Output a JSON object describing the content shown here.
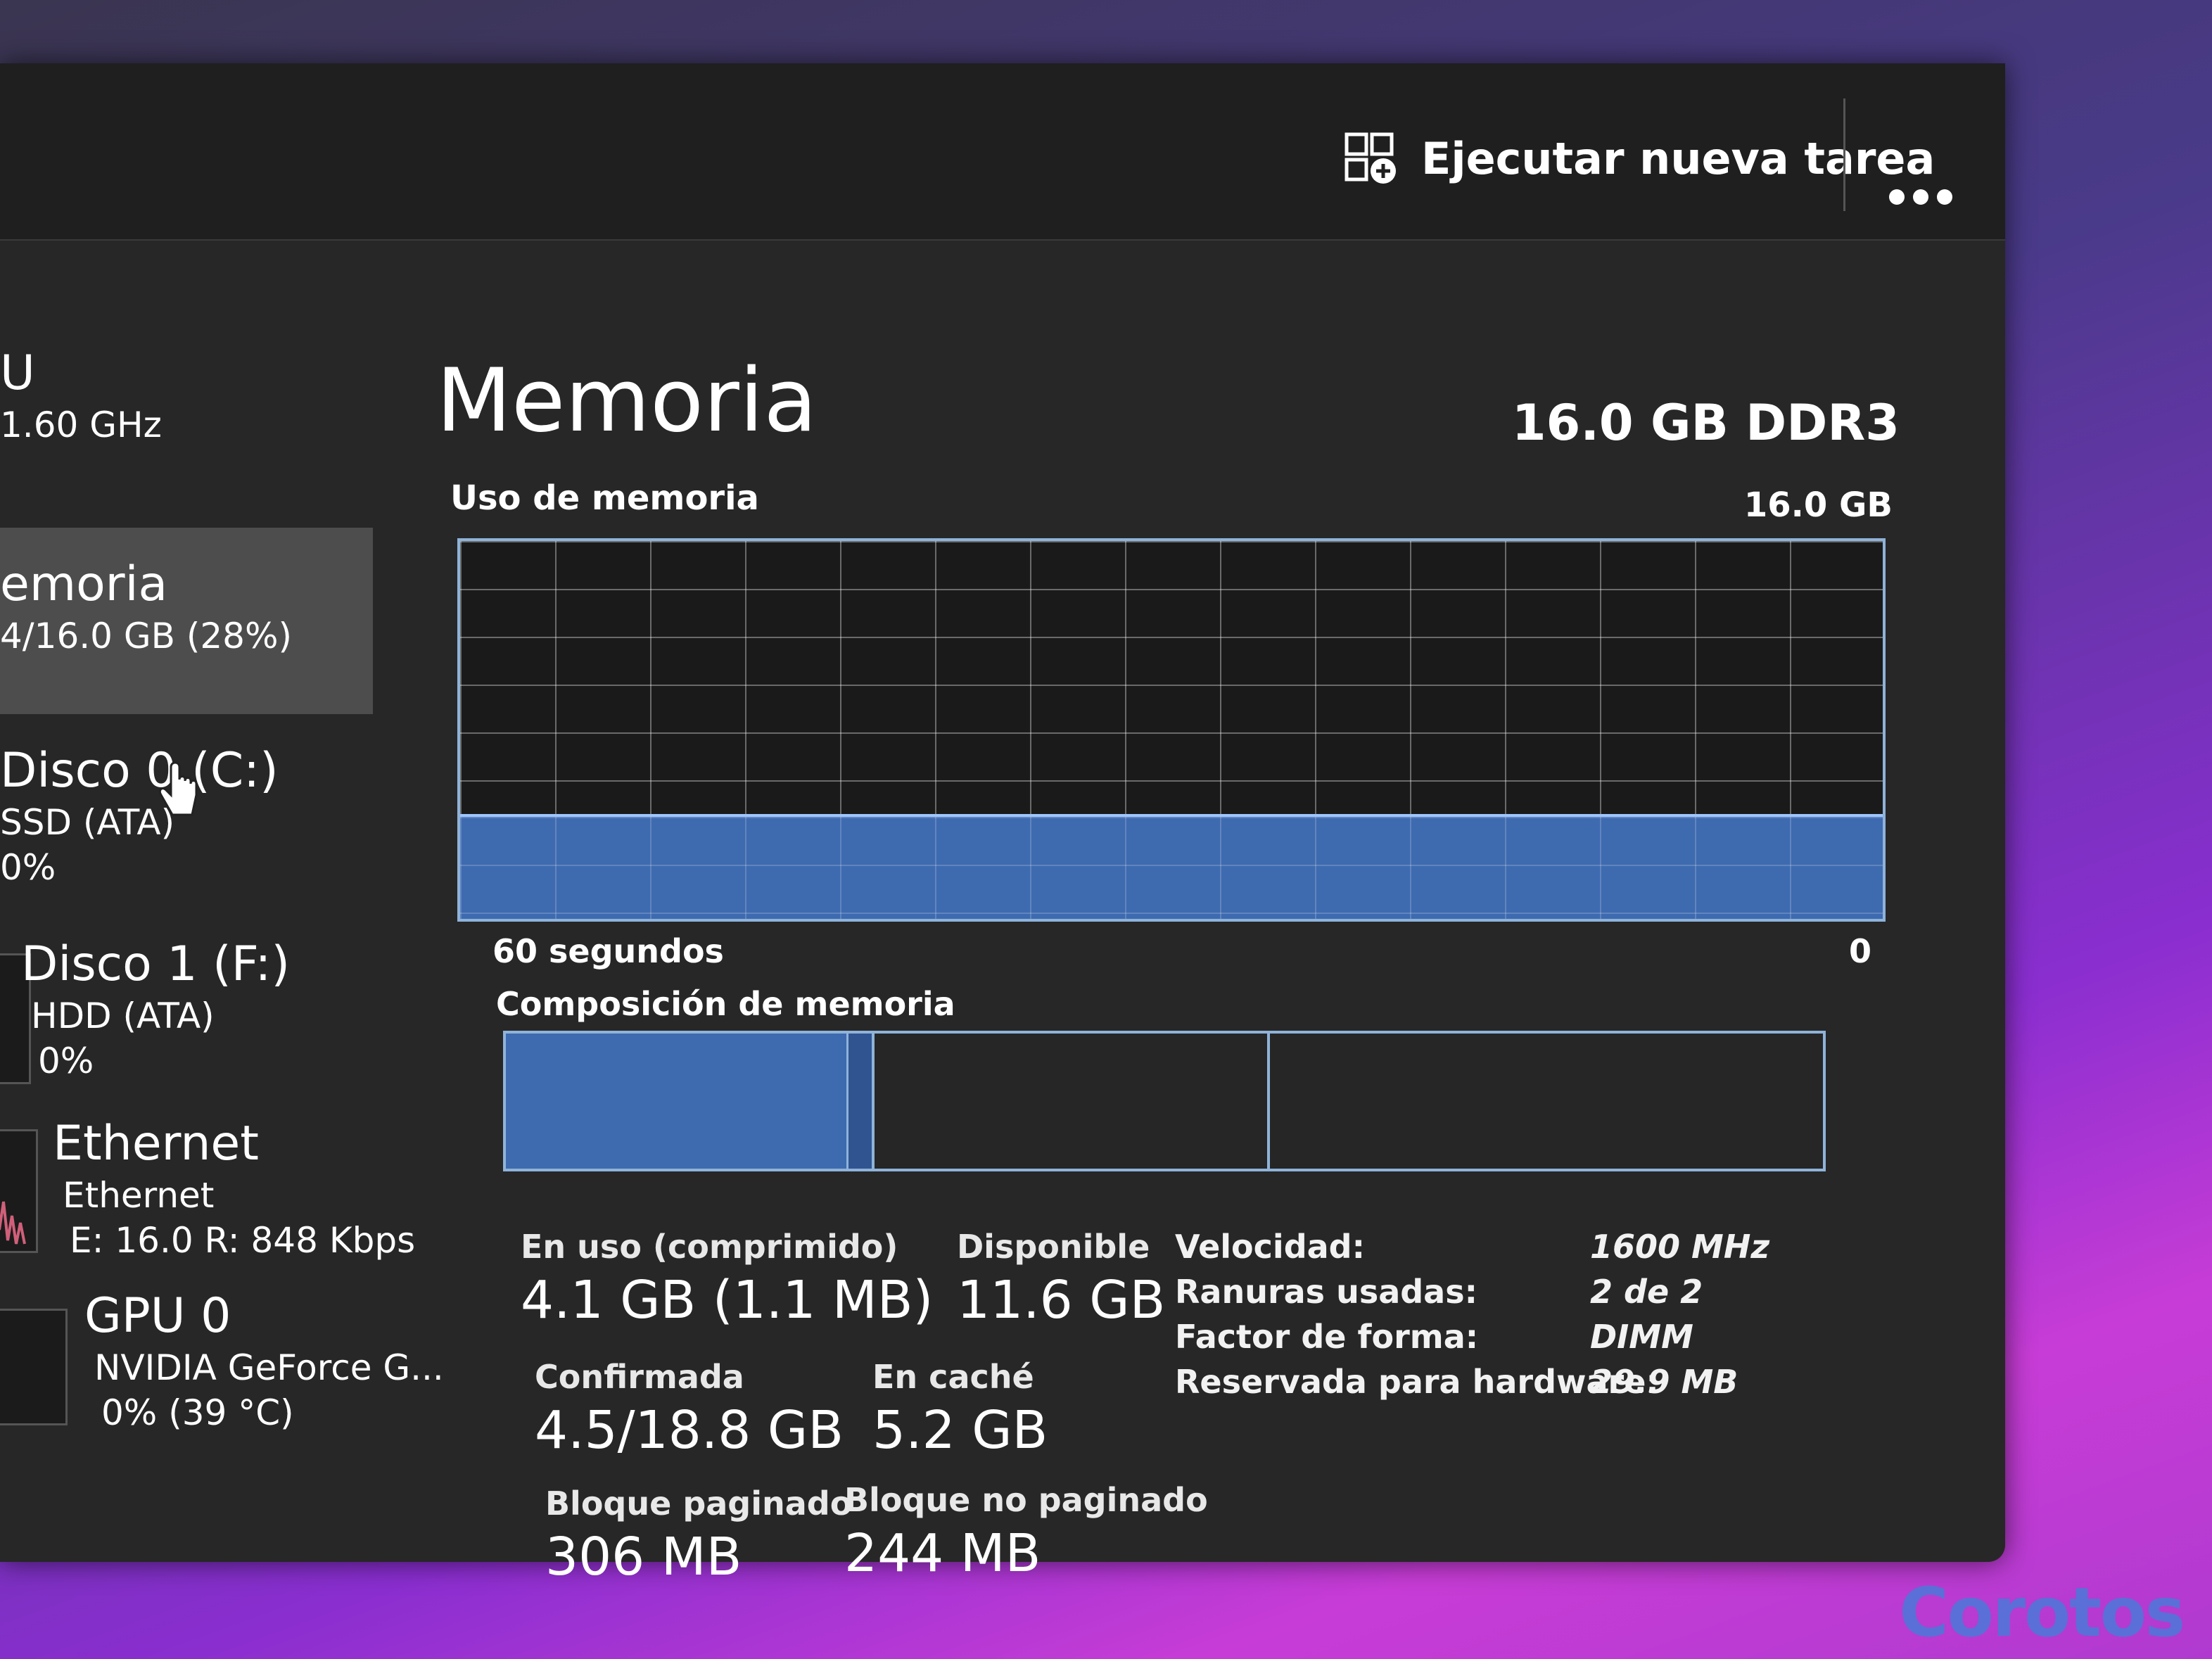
{
  "toolbar": {
    "run_task_label": "Ejecutar nueva tarea",
    "more_icon": "more-horizontal-icon"
  },
  "sidebar": {
    "items": [
      {
        "title": "U",
        "subtitle": "1.60 GHz",
        "selected": false
      },
      {
        "title": "emoria",
        "subtitle": "4/16.0 GB (28%)",
        "selected": true
      },
      {
        "title": "Disco 0 (C:)",
        "subtitle": "SSD (ATA)",
        "value": "0%",
        "selected": false
      },
      {
        "title": "Disco 1 (F:)",
        "subtitle": "HDD (ATA)",
        "value": "0%",
        "selected": false
      },
      {
        "title": "Ethernet",
        "subtitle": "Ethernet",
        "value": "E: 16.0 R: 848 Kbps",
        "selected": false
      },
      {
        "title": "GPU 0",
        "subtitle": "NVIDIA GeForce G...",
        "value": "0% (39 °C)",
        "selected": false
      }
    ]
  },
  "main": {
    "title": "Memoria",
    "spec": "16.0 GB DDR3",
    "usage_label": "Uso de memoria",
    "usage_max": "16.0 GB",
    "axis_left": "60 segundos",
    "axis_right": "0",
    "composition_label": "Composición de memoria",
    "usage_fraction": 0.27,
    "composition": {
      "in_use": 0.26,
      "modified": 0.02,
      "standby": 0.3,
      "free": 0.42
    },
    "colors": {
      "accent": "#3e6ab0",
      "border": "#8fb3d9"
    }
  },
  "stats": {
    "in_use_label": "En uso (comprimido)",
    "in_use_value": "4.1 GB (1.1 MB)",
    "available_label": "Disponible",
    "available_value": "11.6 GB",
    "committed_label": "Confirmada",
    "committed_value": "4.5/18.8 GB",
    "cached_label": "En caché",
    "cached_value": "5.2 GB",
    "paged_label": "Bloque paginado",
    "paged_value": "306 MB",
    "nonpaged_label": "Bloque no paginado",
    "nonpaged_value": "244 MB"
  },
  "properties": [
    {
      "key": "Velocidad:",
      "value": "1600 MHz"
    },
    {
      "key": "Ranuras usadas:",
      "value": "2 de 2"
    },
    {
      "key": "Factor de forma:",
      "value": "DIMM"
    },
    {
      "key": "Reservada para hardware:",
      "value": "29.9 MB"
    }
  ],
  "watermark": "Corotos"
}
